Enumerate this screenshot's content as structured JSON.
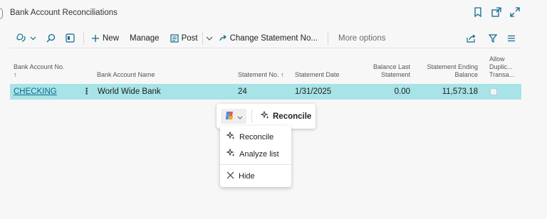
{
  "header": {
    "title": "Bank Account Reconciliations"
  },
  "toolbar": {
    "new": "New",
    "manage": "Manage",
    "post": "Post",
    "change_statement": "Change Statement No...",
    "more_options": "More options"
  },
  "columns": {
    "bank_account_no": "Bank Account No.",
    "bank_account_no_sort": "↑",
    "bank_account_name": "Bank Account Name",
    "statement_no": "Statement No. ↑",
    "statement_date": "Statement Date",
    "balance_last_1": "Balance Last",
    "balance_last_2": "Statement",
    "statement_ending_1": "Statement Ending",
    "statement_ending_2": "Balance",
    "allow_dup_1": "Allow",
    "allow_dup_2": "Duplic...",
    "allow_dup_3": "Transa..."
  },
  "rows": [
    {
      "bank_account_no": "CHECKING",
      "bank_account_name": "World Wide Bank",
      "statement_no": "24",
      "statement_date": "1/31/2025",
      "balance_last_statement": "0.00",
      "statement_ending_balance": "11,573.18",
      "allow_duplication": false
    }
  ],
  "copilot": {
    "reconcile": "Reconcile",
    "menu": {
      "reconcile": "Reconcile",
      "analyze": "Analyze list",
      "hide": "Hide"
    }
  },
  "colors": {
    "accent": "#0d6a8f",
    "selected_row": "#a7e3e7"
  }
}
